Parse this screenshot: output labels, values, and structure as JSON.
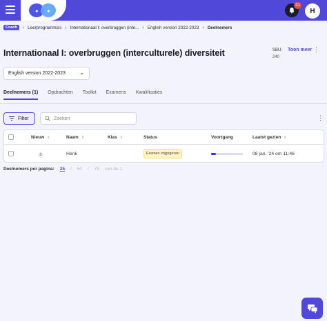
{
  "topbar": {
    "notifications_count": "31",
    "avatar_initial": "H"
  },
  "breadcrumb": {
    "role": "Coach",
    "items": [
      "Leerprogramma's",
      "Internationaal I: overbruggen (inte...",
      "English version 2022-2023",
      "Deelnemers"
    ]
  },
  "page": {
    "title": "Internationaal I: overbruggen (interculturele) diversiteit"
  },
  "sbu": {
    "label": "SBU:",
    "value": "240",
    "toon_meer": "Toon meer"
  },
  "version_select": {
    "value": "English version 2022-2023"
  },
  "tabs": [
    "Deelnemers (1)",
    "Opdrachten",
    "Toolkit",
    "Examens",
    "Kwalificaties"
  ],
  "toolbar": {
    "filter_label": "Filter",
    "search_placeholder": "Zoeken"
  },
  "table": {
    "columns": [
      "Nieuw",
      "Naam",
      "Klas",
      "Status",
      "Voortgang",
      "Laatst gezien"
    ],
    "rows": [
      {
        "nieuw": "0",
        "naam": "Henk",
        "klas": "",
        "status": "Examen vrijgegeven",
        "voortgang": 0.15,
        "laatst_gezien": "08 jan. '24 om 11:46"
      }
    ]
  },
  "pagination": {
    "label": "Deelnemers per pagina:",
    "options": [
      "25",
      "50",
      "75"
    ],
    "selected": "25",
    "range": "van de 1"
  },
  "colors": {
    "accent": "#4f48d8",
    "topbar": "#4f48d8",
    "badge": "#e14b4b",
    "status_bg": "#fff3c8"
  }
}
